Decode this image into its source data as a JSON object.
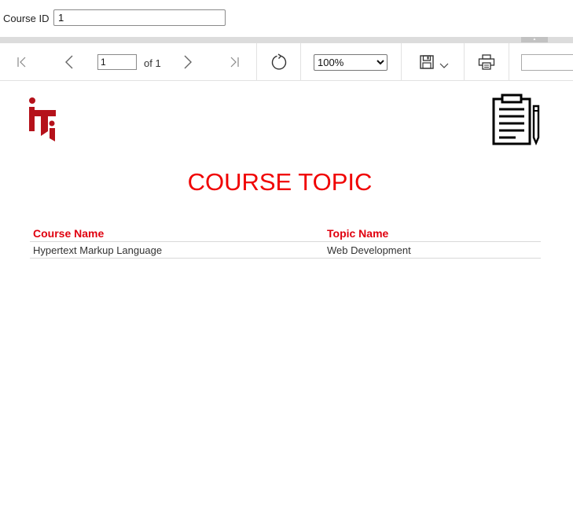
{
  "parameters": {
    "course_id_label": "Course ID",
    "course_id_value": "1"
  },
  "toolbar": {
    "current_page": "1",
    "of_pages": "of 1",
    "zoom": "100%",
    "zoom_options": [
      "100%"
    ],
    "icons": [
      "first-page-icon",
      "previous-page-icon",
      "next-page-icon",
      "last-page-icon",
      "refresh-icon",
      "save-icon",
      "dropdown-chevron-icon",
      "print-icon"
    ]
  },
  "report": {
    "title": "COURSE TOPIC",
    "columns": [
      "Course Name",
      "Topic Name"
    ],
    "rows": [
      [
        "Hypertext Markup Language",
        "Web Development"
      ]
    ],
    "colors": {
      "title": "#f00000",
      "header": "#e0000f",
      "logo": "#b5121b"
    }
  }
}
